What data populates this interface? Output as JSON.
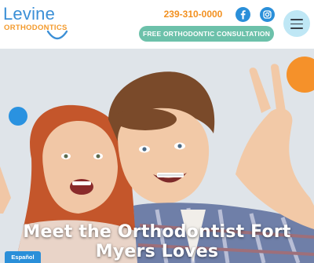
{
  "header": {
    "logo_name": "Levine",
    "logo_sub": "ORTHODONTICS",
    "phone": "239-310-0000",
    "consult_label": "FREE ORTHODONTIC CONSULTATION",
    "social": [
      {
        "icon": "facebook-icon"
      },
      {
        "icon": "instagram-icon"
      }
    ],
    "menu_icon": "hamburger-menu-icon"
  },
  "hero": {
    "title_line1": "Meet the Orthodontist Fort",
    "title_line2": "Myers Loves"
  },
  "language_tab": "Español",
  "colors": {
    "brand_blue": "#2a8fd9",
    "brand_orange": "#f2901f",
    "consult_green": "#6cc1aa",
    "menu_bg": "#bfe7f5"
  }
}
